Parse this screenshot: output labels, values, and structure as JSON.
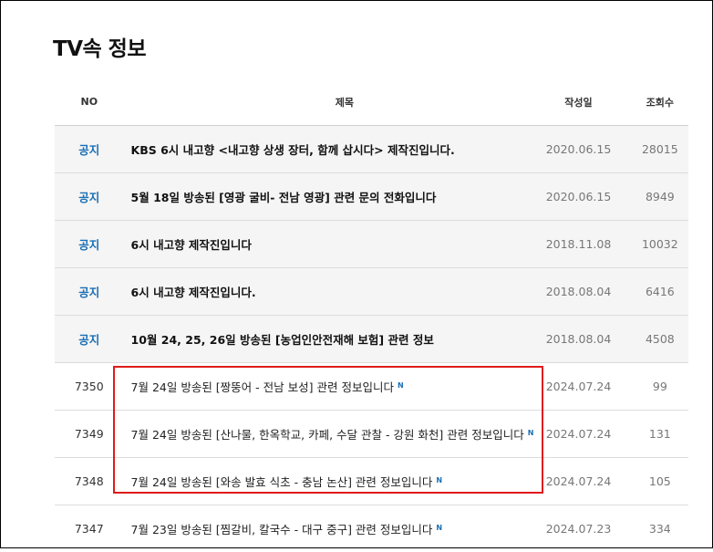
{
  "page": {
    "title": "TV속 정보"
  },
  "table": {
    "headers": {
      "no": "NO",
      "title": "제목",
      "date": "작성일",
      "views": "조회수"
    },
    "notices": [
      {
        "no": "공지",
        "title": "KBS 6시 내고향 <내고향 상생 장터, 함께 삽시다> 제작진입니다.",
        "date": "2020.06.15",
        "views": "28015"
      },
      {
        "no": "공지",
        "title": "5월 18일 방송된 [영광 굴비- 전남 영광] 관련 문의 전화입니다",
        "date": "2020.06.15",
        "views": "8949"
      },
      {
        "no": "공지",
        "title": "6시 내고향 제작진입니다",
        "date": "2018.11.08",
        "views": "10032"
      },
      {
        "no": "공지",
        "title": "6시 내고향 제작진입니다.",
        "date": "2018.08.04",
        "views": "6416"
      },
      {
        "no": "공지",
        "title": "10월 24, 25, 26일 방송된 [농업인안전재해 보험] 관련 정보",
        "date": "2018.08.04",
        "views": "4508"
      }
    ],
    "posts": [
      {
        "no": "7350",
        "title": "7월 24일 방송된 [짱뚱어 - 전남 보성] 관련 정보입니다",
        "badge": "N",
        "date": "2024.07.24",
        "views": "99"
      },
      {
        "no": "7349",
        "title": "7월 24일 방송된 [산나물, 한옥학교, 카페, 수달 관찰 - 강원 화천] 관련 정보입니다",
        "badge": "N",
        "date": "2024.07.24",
        "views": "131"
      },
      {
        "no": "7348",
        "title": "7월 24일 방송된 [와송 발효 식초 - 충남 논산] 관련 정보입니다",
        "badge": "N",
        "date": "2024.07.24",
        "views": "105"
      },
      {
        "no": "7347",
        "title": "7월 23일 방송된 [찜갈비, 칼국수 - 대구 중구] 관련 정보입니다",
        "badge": "N",
        "date": "2024.07.23",
        "views": "334"
      }
    ]
  },
  "colors": {
    "notice_label": "#1a6fb5",
    "new_badge": "#1a6fb5",
    "highlight_border": "#e01b1b",
    "notice_row_bg": "#f5f5f5"
  }
}
